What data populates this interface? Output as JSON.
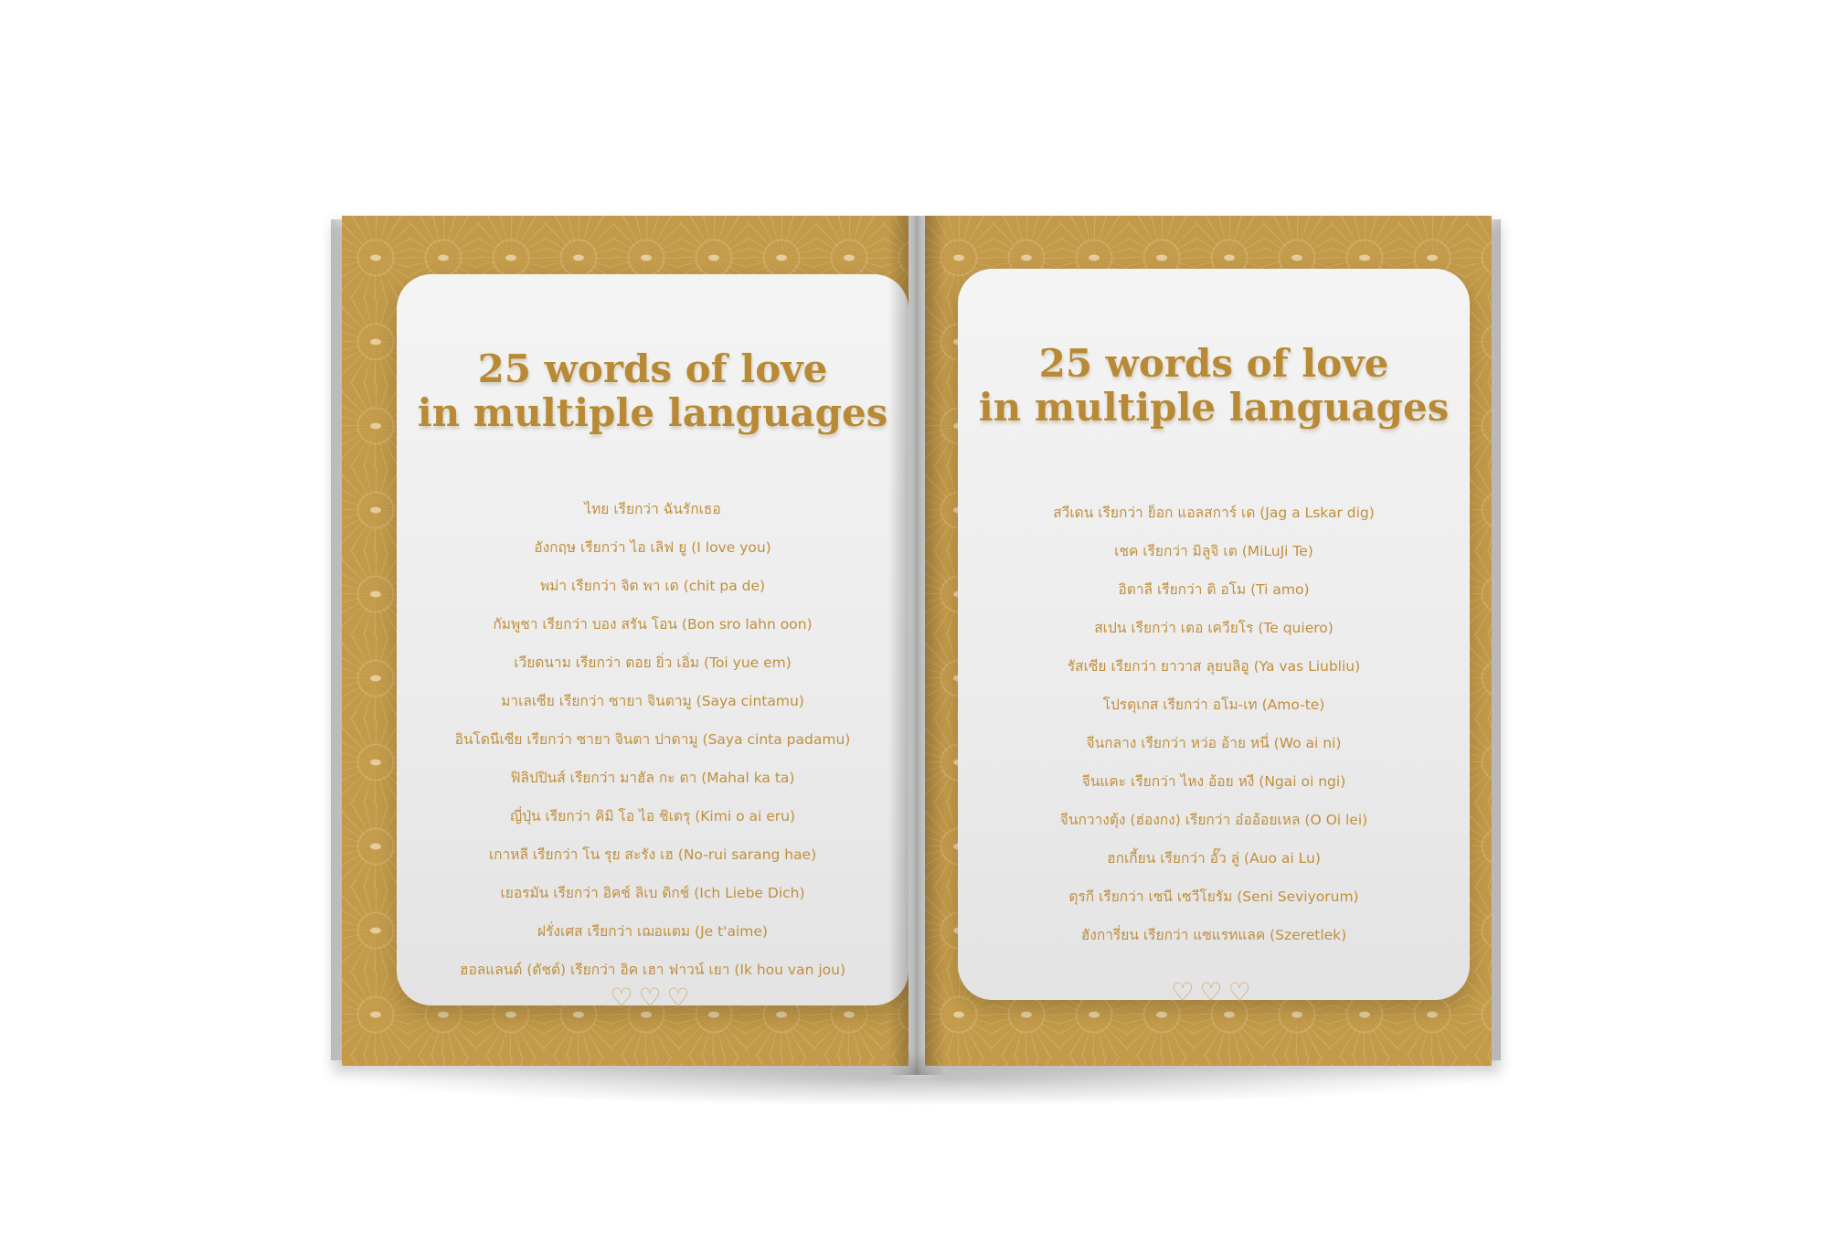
{
  "left_page": {
    "title_line1": "25 words of love",
    "title_line2": "in multiple languages",
    "items": [
      "ไทย เรียกว่า ฉันรักเธอ",
      "อังกฤษ เรียกว่า ไอ เลิฟ ยู (I love you)",
      "พม่า เรียกว่า จิต พา เด (chit pa de)",
      "กัมพูชา เรียกว่า บอง สรัน โอน (Bon sro lahn oon)",
      "เวียดนาม เรียกว่า ตอย ยิ่ว เอิ่ม (Toi yue em)",
      "มาเลเซีย เรียกว่า ซายา จินตามู (Saya cintamu)",
      "อินโดนีเซีย เรียกว่า ซายา จินตา ปาดามู (Saya cinta padamu)",
      "ฟิลิปปินส์ เรียกว่า มาฮัล กะ ตา (Mahal ka ta)",
      "ญี่ปุ่น เรียกว่า คิมิ โอ ไอ ชิเตรุ (Kimi o ai eru)",
      "เกาหลี เรียกว่า โน รุย สะรัง เฮ (No-rui sarang hae)",
      "เยอรมัน เรียกว่า อิคช์ ลิเบ ดิกช์ (Ich Liebe Dich)",
      "ฝรั่งเศส เรียกว่า เฌอแตม (Je t'aime)",
      "ฮอลแลนด์ (ดัชต์) เรียกว่า อิค เฮา ฟาวน์ เยา (Ik hou van jou)"
    ],
    "hearts": "♡♡♡"
  },
  "right_page": {
    "title_line1": "25 words of love",
    "title_line2": "in multiple languages",
    "items": [
      "สวีเดน เรียกว่า ย็อก แอลสการ์ เด (Jag a Lskar dig)",
      "เชค เรียกว่า มิลูจิ เต (MiLuJi Te)",
      "อิตาลี เรียกว่า ติ อโม (Ti amo)",
      "สเปน เรียกว่า เตอ เควียโร (Te quiero)",
      "รัสเซีย เรียกว่า ยาวาส ลุยบลิอู (Ya vas Liubliu)",
      "โปรตุเกส เรียกว่า อโม-เท (Amo-te)",
      "จีนกลาง เรียกว่า หว่อ อ้าย หนี่ (Wo ai ni)",
      "จีนแคะ เรียกว่า ไหง อ้อย หงี (Ngai oi ngi)",
      "จีนกวางตุ้ง (ฮ่องกง) เรียกว่า อ๋ออ้อยเหล (O Oi lei)",
      "ฮกเกี้ยน เรียกว่า อั๊ว ลู่ (Auo ai Lu)",
      "ตุรกี เรียกว่า เซนี เซวีโยรัม (Seni Seviyorum)",
      "ฮังการี่ยน เรียกว่า แซแรทแลค (Szeretlek)"
    ],
    "hearts": "♡♡♡"
  }
}
